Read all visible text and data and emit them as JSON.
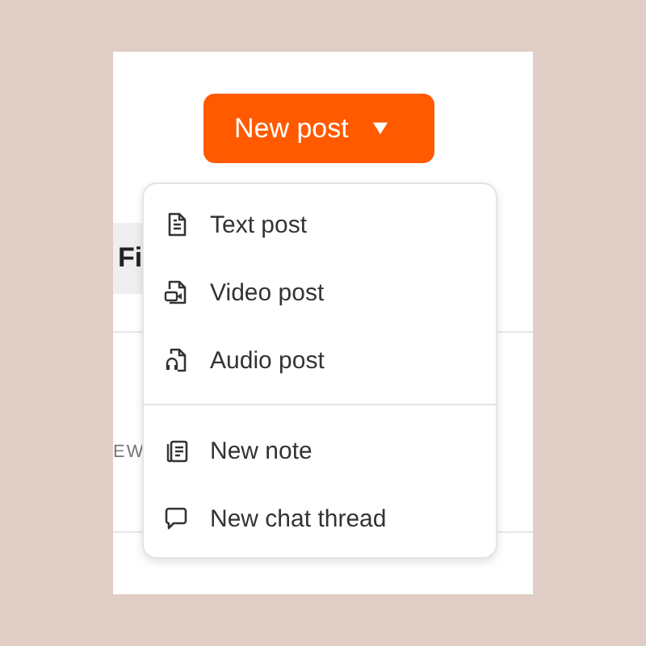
{
  "new_post_button": {
    "label": "New post"
  },
  "background": {
    "tab": "Fi",
    "caption": "EW"
  },
  "menu": {
    "sections": [
      {
        "items": [
          {
            "kind": "text",
            "label": "Text post"
          },
          {
            "kind": "video",
            "label": "Video post"
          },
          {
            "kind": "audio",
            "label": "Audio post"
          }
        ]
      },
      {
        "items": [
          {
            "kind": "note",
            "label": "New note"
          },
          {
            "kind": "chat",
            "label": "New chat thread"
          }
        ]
      }
    ]
  }
}
